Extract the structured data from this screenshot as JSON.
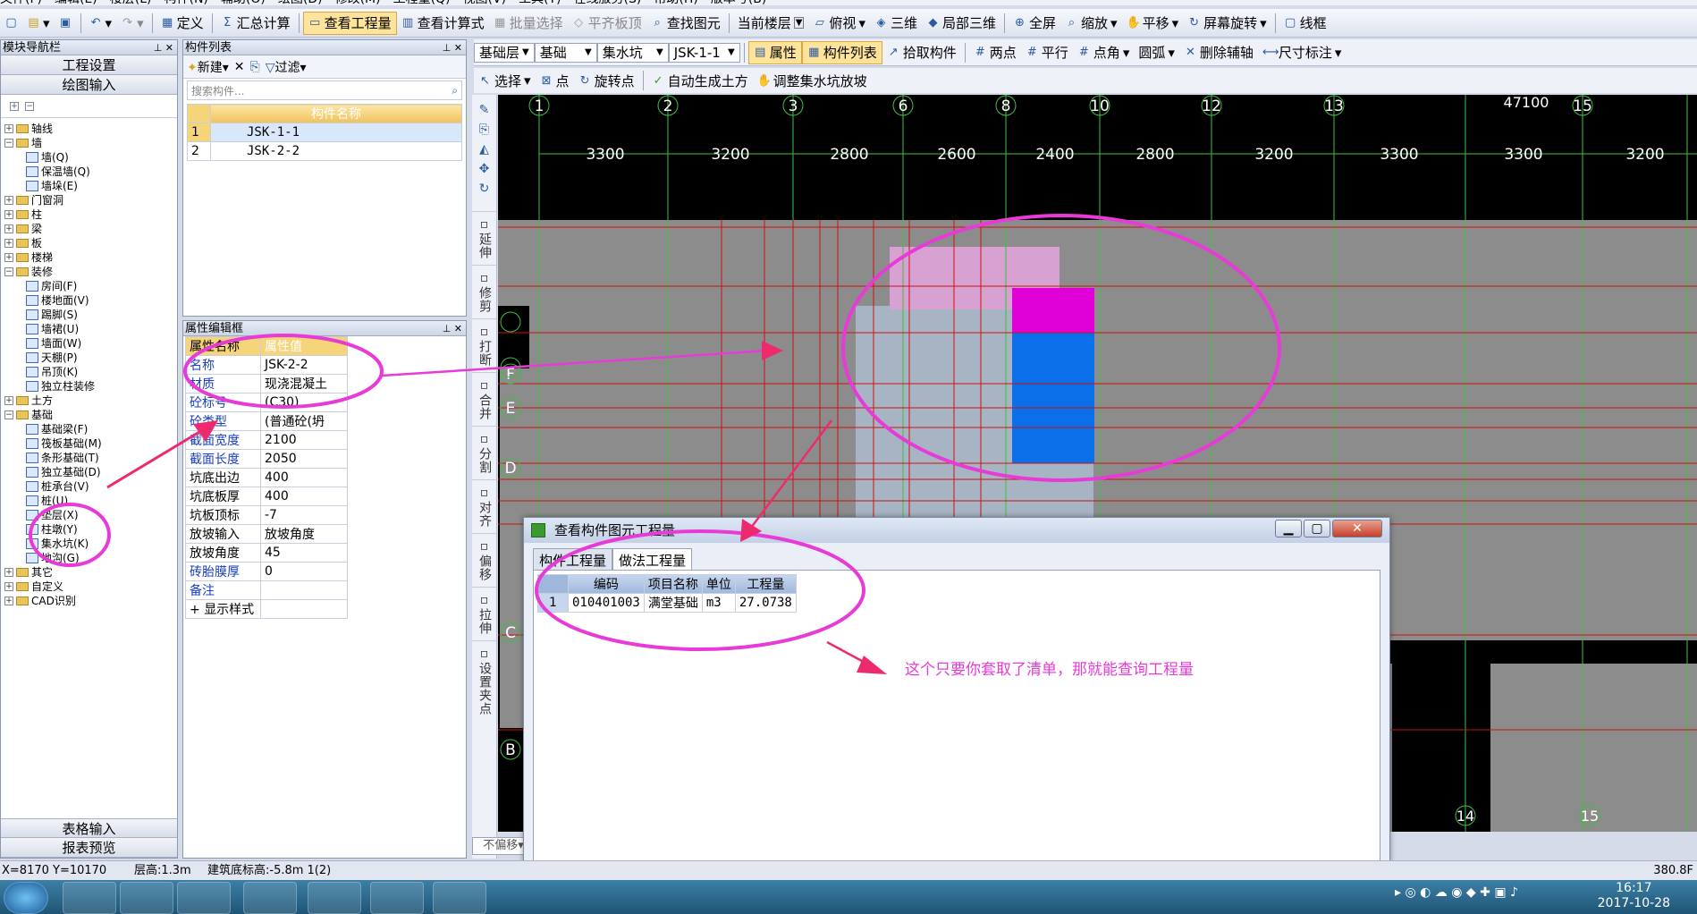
{
  "menu": [
    "文件(F)",
    "编辑(E)",
    "楼层(L)",
    "构件(N)",
    "辅助(O)",
    "绘图(D)",
    "修改(M)",
    "工程量(Q)",
    "视图(V)",
    "工具(T)",
    "在线服务(S)",
    "帮助(H)",
    "版本号(B)"
  ],
  "toolbar1": {
    "define": "定义",
    "sum_calc": "汇总计算",
    "view_qty": "查看工程量",
    "view_formula": "查看计算式",
    "batch_select": "批量选择",
    "align_slab": "平齐板顶",
    "find_elem": "查找图元",
    "current_floor": "当前楼层",
    "top_view": "俯视",
    "three_d": "三维",
    "local_3d": "局部三维",
    "fullscreen": "全屏",
    "zoom": "缩放",
    "pan": "平移",
    "screen_rotate": "屏幕旋转",
    "wireframe": "线框"
  },
  "toolbar2": {
    "floor": "基础层",
    "category": "基础",
    "type": "集水坑",
    "component": "JSK-1-1",
    "attr": "属性",
    "comp_list": "构件列表",
    "pick": "拾取构件",
    "two_points": "两点",
    "parallel": "平行",
    "point_angle": "点角",
    "arc": "圆弧",
    "delete_aux": "删除辅轴",
    "dimension": "尺寸标注"
  },
  "toolbar3": {
    "select": "选择",
    "point": "点",
    "rotate_point": "旋转点",
    "auto_earth": "自动生成土方",
    "adjust_slope": "调整集水坑放坡"
  },
  "nav": {
    "title": "模块导航栏",
    "project_settings": "工程设置",
    "draw_input": "绘图输入",
    "table_input": "表格输入",
    "report_preview": "报表预览",
    "tree": [
      {
        "label": "轴线",
        "level": 0,
        "kind": "folder"
      },
      {
        "label": "墙",
        "level": 0,
        "kind": "folder",
        "open": true
      },
      {
        "label": "墙(Q)",
        "level": 1,
        "kind": "item"
      },
      {
        "label": "保温墙(Q)",
        "level": 1,
        "kind": "item"
      },
      {
        "label": "墙垛(E)",
        "level": 1,
        "kind": "item"
      },
      {
        "label": "门窗洞",
        "level": 0,
        "kind": "folder"
      },
      {
        "label": "柱",
        "level": 0,
        "kind": "folder"
      },
      {
        "label": "梁",
        "level": 0,
        "kind": "folder"
      },
      {
        "label": "板",
        "level": 0,
        "kind": "folder"
      },
      {
        "label": "楼梯",
        "level": 0,
        "kind": "folder"
      },
      {
        "label": "装修",
        "level": 0,
        "kind": "folder",
        "open": true
      },
      {
        "label": "房间(F)",
        "level": 1,
        "kind": "item"
      },
      {
        "label": "楼地面(V)",
        "level": 1,
        "kind": "item"
      },
      {
        "label": "踢脚(S)",
        "level": 1,
        "kind": "item"
      },
      {
        "label": "墙裙(U)",
        "level": 1,
        "kind": "item"
      },
      {
        "label": "墙面(W)",
        "level": 1,
        "kind": "item"
      },
      {
        "label": "天棚(P)",
        "level": 1,
        "kind": "item"
      },
      {
        "label": "吊顶(K)",
        "level": 1,
        "kind": "item"
      },
      {
        "label": "独立柱装修",
        "level": 1,
        "kind": "item"
      },
      {
        "label": "土方",
        "level": 0,
        "kind": "folder"
      },
      {
        "label": "基础",
        "level": 0,
        "kind": "folder",
        "open": true
      },
      {
        "label": "基础梁(F)",
        "level": 1,
        "kind": "item"
      },
      {
        "label": "筏板基础(M)",
        "level": 1,
        "kind": "item"
      },
      {
        "label": "条形基础(T)",
        "level": 1,
        "kind": "item"
      },
      {
        "label": "独立基础(D)",
        "level": 1,
        "kind": "item"
      },
      {
        "label": "桩承台(V)",
        "level": 1,
        "kind": "item"
      },
      {
        "label": "桩(U)",
        "level": 1,
        "kind": "item"
      },
      {
        "label": "垫层(X)",
        "level": 1,
        "kind": "item"
      },
      {
        "label": "柱墩(Y)",
        "level": 1,
        "kind": "item"
      },
      {
        "label": "集水坑(K)",
        "level": 1,
        "kind": "item"
      },
      {
        "label": "地沟(G)",
        "level": 1,
        "kind": "item"
      },
      {
        "label": "其它",
        "level": 0,
        "kind": "folder"
      },
      {
        "label": "自定义",
        "level": 0,
        "kind": "folder"
      },
      {
        "label": "CAD识别",
        "level": 0,
        "kind": "folder"
      }
    ]
  },
  "comp_list": {
    "title": "构件列表",
    "new_btn": "新建",
    "filter_btn": "过滤",
    "search_placeholder": "搜索构件...",
    "col_name": "构件名称",
    "rows": [
      {
        "idx": "1",
        "name": "JSK-1-1"
      },
      {
        "idx": "2",
        "name": "JSK-2-2"
      }
    ]
  },
  "props": {
    "title": "属性编辑框",
    "col_name": "属性名称",
    "col_value": "属性值",
    "rows": [
      {
        "name": "名称",
        "value": "JSK-2-2",
        "blue": true
      },
      {
        "name": "材质",
        "value": "现浇混凝土",
        "blue": true
      },
      {
        "name": "砼标号",
        "value": "(C30)",
        "blue": true
      },
      {
        "name": "砼类型",
        "value": "(普通砼(坍",
        "blue": true
      },
      {
        "name": "截面宽度",
        "value": "2100",
        "blue": true
      },
      {
        "name": "截面长度",
        "value": "2050",
        "blue": true
      },
      {
        "name": "坑底出边",
        "value": "400",
        "blue": false
      },
      {
        "name": "坑底板厚",
        "value": "400",
        "blue": false
      },
      {
        "name": "坑板顶标",
        "value": "-7",
        "blue": false
      },
      {
        "name": "放坡输入",
        "value": "放坡角度",
        "blue": false
      },
      {
        "name": "放坡角度",
        "value": "45",
        "blue": false
      },
      {
        "name": "砖胎膜厚",
        "value": "0",
        "blue": true
      },
      {
        "name": "备注",
        "value": "",
        "blue": true
      },
      {
        "name": "显示样式",
        "value": "",
        "blue": false
      }
    ]
  },
  "vtools": [
    "延伸",
    "修剪",
    "打断",
    "合并",
    "分割",
    "对齐",
    "偏移",
    "拉伸",
    "设置夹点"
  ],
  "cad": {
    "axis_top": [
      "1",
      "2",
      "3",
      "6",
      "8",
      "10",
      "12",
      "13",
      "15"
    ],
    "dims": [
      "3300",
      "3200",
      "2800",
      "2600",
      "2400",
      "2800",
      "3200",
      "3300",
      "3300",
      "3200"
    ],
    "total": "47100",
    "axis_left": [
      "F",
      "E",
      "D",
      "C",
      "B"
    ],
    "axis_bottom": [
      "14",
      "15"
    ],
    "mode_label": "不偏移"
  },
  "dialog": {
    "title": "查看构件图元工程量",
    "tab1": "构件工程量",
    "tab2": "做法工程量",
    "headers": [
      "编码",
      "项目名称",
      "单位",
      "工程量"
    ],
    "rows": [
      {
        "idx": "1",
        "code": "010401003",
        "name": "满堂基础",
        "unit": "m3",
        "qty": "27.0738"
      }
    ]
  },
  "annotation": "这个只要你套取了清单，那就能查询工程量",
  "status": {
    "coords": "X=8170 Y=10170",
    "floor_height": "层高:1.3m",
    "base_elev": "建筑底标高:-5.8m 1(2)",
    "right": "380.8F"
  },
  "clock": {
    "time": "16:17",
    "date": "2017-10-28"
  },
  "colors": {
    "accent": "#e83ad6",
    "cad_bg": "#000000",
    "grid": "#d01010",
    "pit_blue": "#0a6fe8",
    "pit_magenta": "#e000d8"
  }
}
